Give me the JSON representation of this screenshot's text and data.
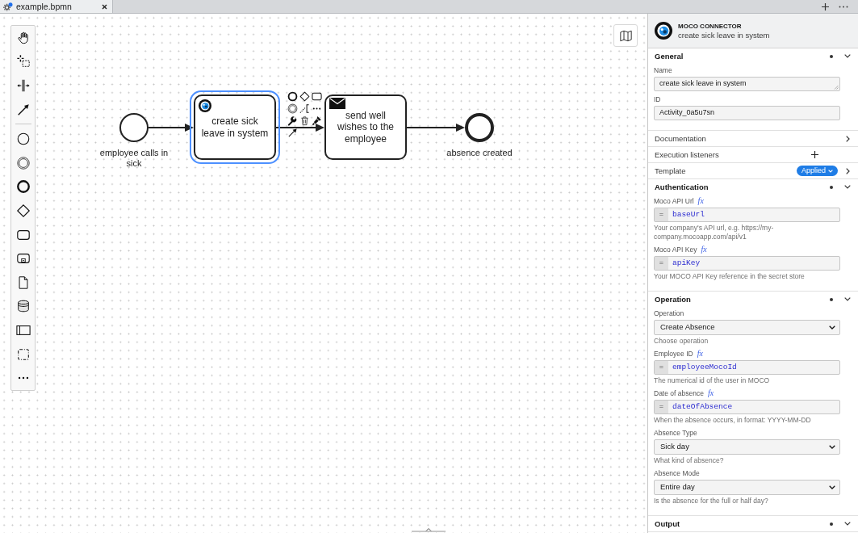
{
  "tab_bar": {
    "tabs": [
      {
        "title": "example.bpmn",
        "selected": true
      }
    ]
  },
  "diagram": {
    "elements": [
      {
        "kind": "start_event",
        "label": "employee calls in sick",
        "selected": false
      },
      {
        "kind": "service_task",
        "label": "create sick leave in system",
        "selected": true
      },
      {
        "kind": "send_task",
        "label": "send well wishes to the employee",
        "selected": false
      },
      {
        "kind": "end_event",
        "label": "absence created",
        "selected": false
      }
    ]
  },
  "properties_panel": {
    "header": {
      "type": "MOCO CONNECTOR",
      "name": "create sick leave in system"
    },
    "groups": [
      {
        "kind": "section",
        "title": "General",
        "has_data": true,
        "expanded": true,
        "entries": [
          {
            "kind": "textarea",
            "label": "Name",
            "value": "create sick leave in system"
          },
          {
            "kind": "text",
            "label": "ID",
            "value": "Activity_0a5u7sn"
          }
        ]
      },
      {
        "kind": "section",
        "title": "Documentation",
        "has_data": false,
        "expanded": false
      },
      {
        "kind": "list",
        "title": "Execution listeners"
      },
      {
        "kind": "template",
        "title": "Template",
        "badge": "Applied",
        "expanded": false
      },
      {
        "kind": "section",
        "title": "Authentication",
        "has_data": true,
        "expanded": true,
        "entries": [
          {
            "kind": "feel",
            "label": "Moco API Url",
            "feel_marker": "fx",
            "prefix": "=",
            "value": "baseUrl",
            "description": "Your company's API url, e.g. https://my-company.mocoapp.com/api/v1"
          },
          {
            "kind": "feel",
            "label": "Moco API Key",
            "feel_marker": "fx",
            "prefix": "=",
            "value": "apiKey",
            "description": "Your MOCO API Key reference in the secret store"
          }
        ]
      },
      {
        "kind": "section",
        "title": "Operation",
        "has_data": true,
        "expanded": true,
        "entries": [
          {
            "kind": "select",
            "label": "Operation",
            "value": "Create Absence",
            "description": "Choose operation"
          },
          {
            "kind": "feel",
            "label": "Employee ID",
            "feel_marker": "fx",
            "prefix": "=",
            "value": "employeeMocoId",
            "description": "The numerical id of the user in MOCO"
          },
          {
            "kind": "feel",
            "label": "Date of absence",
            "feel_marker": "fx",
            "prefix": "=",
            "value": "dateOfAbsence",
            "description": "When the absence occurs, in format: YYYY-MM-DD"
          },
          {
            "kind": "select",
            "label": "Absence Type",
            "value": "Sick day",
            "description": "What kind of absence?"
          },
          {
            "kind": "select",
            "label": "Absence Mode",
            "value": "Entire day",
            "description": "Is the absence for the full or half day?"
          }
        ]
      },
      {
        "kind": "section",
        "title": "Output",
        "has_data": true,
        "expanded": true
      }
    ]
  }
}
